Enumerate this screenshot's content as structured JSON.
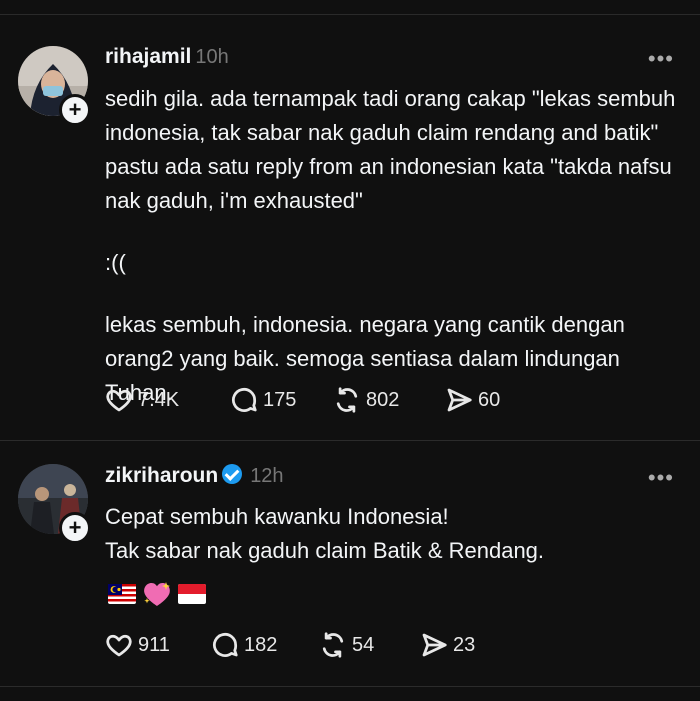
{
  "post1": {
    "username": "rihajamil",
    "time": "10h",
    "more": "•••",
    "paragraphs": [
      "sedih gila. ada ternampak tadi orang cakap \"lekas sembuh indonesia, tak sabar nak gaduh claim rendang and batik\" pastu ada satu reply from an indonesian kata \"takda nafsu nak gaduh, i'm exhausted\"",
      ":((",
      "lekas sembuh, indonesia. negara yang cantik dengan orang2 yang baik. semoga sentiasa dalam lindungan Tuhan."
    ],
    "likes": "7.4K",
    "replies": "175",
    "reposts": "802",
    "shares": "60"
  },
  "post2": {
    "username": "zikriharoun",
    "time": "12h",
    "more": "•••",
    "paragraphs": [
      "Cepat sembuh kawanku Indonesia!",
      "Tak sabar nak gaduh claim Batik & Rendang."
    ],
    "emojis": [
      "malaysia-flag",
      "sparkling-heart",
      "indonesia-flag"
    ],
    "likes": "911",
    "replies": "182",
    "reposts": "54",
    "shares": "23"
  },
  "colors": {
    "background": "#101010",
    "text": "#f3f5f7",
    "muted": "#777777",
    "verified": "#1d9bf0"
  }
}
